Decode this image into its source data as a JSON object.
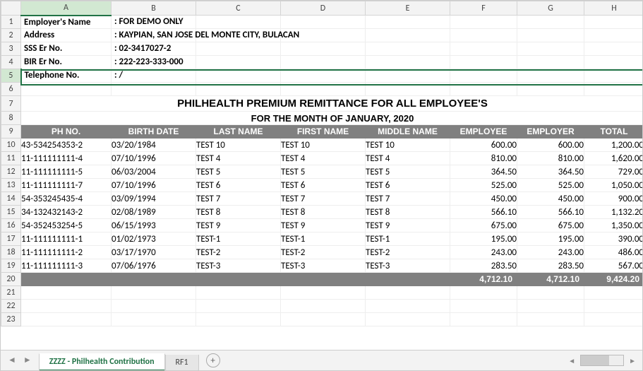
{
  "columns": [
    "A",
    "B",
    "C",
    "D",
    "E",
    "F",
    "G",
    "H"
  ],
  "selected_column": "A",
  "selected_row": 5,
  "info_labels": {
    "employer_name": "Employer's Name",
    "address": "Address",
    "sss": "SSS Er No.",
    "bir": "BIR Er No.",
    "tel": "Telephone No."
  },
  "info_values": {
    "employer_name": ": FOR DEMO ONLY",
    "address": ": KAYPIAN, SAN JOSE DEL MONTE CITY, BULACAN",
    "sss": ": 02-3417027-2",
    "bir": ": 222-223-333-000",
    "tel": ": /"
  },
  "title": "PHILHEALTH PREMIUM REMITTANCE FOR ALL EMPLOYEE'S",
  "subtitle": "FOR THE MONTH OF JANUARY, 2020",
  "headers": [
    "PH NO.",
    "BIRTH DATE",
    "LAST NAME",
    "FIRST NAME",
    "MIDDLE NAME",
    "EMPLOYEE",
    "EMPLOYER",
    "TOTAL"
  ],
  "rows": [
    {
      "ph": "43-534254353-2",
      "bd": "03/20/1984",
      "ln": "TEST 10",
      "fn": "TEST 10",
      "mn": "TEST 10",
      "ee": "600.00",
      "er": "600.00",
      "tot": "1,200.00"
    },
    {
      "ph": "11-111111111-4",
      "bd": "07/10/1996",
      "ln": "TEST 4",
      "fn": "TEST 4",
      "mn": "TEST 4",
      "ee": "810.00",
      "er": "810.00",
      "tot": "1,620.00"
    },
    {
      "ph": "11-111111111-5",
      "bd": "06/03/2004",
      "ln": "TEST 5",
      "fn": "TEST 5",
      "mn": "TEST 5",
      "ee": "364.50",
      "er": "364.50",
      "tot": "729.00"
    },
    {
      "ph": "11-111111111-7",
      "bd": "07/10/1996",
      "ln": "TEST 6",
      "fn": "TEST 6",
      "mn": "TEST 6",
      "ee": "525.00",
      "er": "525.00",
      "tot": "1,050.00"
    },
    {
      "ph": "54-353245435-4",
      "bd": "03/09/1994",
      "ln": "TEST 7",
      "fn": "TEST 7",
      "mn": "TEST 7",
      "ee": "450.00",
      "er": "450.00",
      "tot": "900.00"
    },
    {
      "ph": "34-132432143-2",
      "bd": "02/08/1989",
      "ln": "TEST 8",
      "fn": "TEST 8",
      "mn": "TEST 8",
      "ee": "566.10",
      "er": "566.10",
      "tot": "1,132.20"
    },
    {
      "ph": "54-352453254-5",
      "bd": "06/15/1993",
      "ln": "TEST 9",
      "fn": "TEST 9",
      "mn": "TEST 9",
      "ee": "675.00",
      "er": "675.00",
      "tot": "1,350.00"
    },
    {
      "ph": "11-111111111-1",
      "bd": "01/02/1973",
      "ln": "TEST-1",
      "fn": "TEST-1",
      "mn": "TEST-1",
      "ee": "195.00",
      "er": "195.00",
      "tot": "390.00"
    },
    {
      "ph": "11-111111111-2",
      "bd": "03/17/1970",
      "ln": "TEST-2",
      "fn": "TEST-2",
      "mn": "TEST-2",
      "ee": "243.00",
      "er": "243.00",
      "tot": "486.00"
    },
    {
      "ph": "11-111111111-3",
      "bd": "07/06/1976",
      "ln": "TEST-3",
      "fn": "TEST-3",
      "mn": "TEST-3",
      "ee": "283.50",
      "er": "283.50",
      "tot": "567.00"
    }
  ],
  "totals": {
    "ee": "4,712.10",
    "er": "4,712.10",
    "tot": "9,424.20"
  },
  "tabs": {
    "active": "ZZZZ - Philhealth Contribution",
    "other": "RF1"
  },
  "chart_data": {
    "type": "table",
    "title": "PHILHEALTH PREMIUM REMITTANCE FOR ALL EMPLOYEE'S",
    "subtitle": "FOR THE MONTH OF JANUARY, 2020",
    "columns": [
      "PH NO.",
      "BIRTH DATE",
      "LAST NAME",
      "FIRST NAME",
      "MIDDLE NAME",
      "EMPLOYEE",
      "EMPLOYER",
      "TOTAL"
    ],
    "rows": [
      [
        "43-534254353-2",
        "03/20/1984",
        "TEST 10",
        "TEST 10",
        "TEST 10",
        600.0,
        600.0,
        1200.0
      ],
      [
        "11-111111111-4",
        "07/10/1996",
        "TEST 4",
        "TEST 4",
        "TEST 4",
        810.0,
        810.0,
        1620.0
      ],
      [
        "11-111111111-5",
        "06/03/2004",
        "TEST 5",
        "TEST 5",
        "TEST 5",
        364.5,
        364.5,
        729.0
      ],
      [
        "11-111111111-7",
        "07/10/1996",
        "TEST 6",
        "TEST 6",
        "TEST 6",
        525.0,
        525.0,
        1050.0
      ],
      [
        "54-353245435-4",
        "03/09/1994",
        "TEST 7",
        "TEST 7",
        "TEST 7",
        450.0,
        450.0,
        900.0
      ],
      [
        "34-132432143-2",
        "02/08/1989",
        "TEST 8",
        "TEST 8",
        "TEST 8",
        566.1,
        566.1,
        1132.2
      ],
      [
        "54-352453254-5",
        "06/15/1993",
        "TEST 9",
        "TEST 9",
        "TEST 9",
        675.0,
        675.0,
        1350.0
      ],
      [
        "11-111111111-1",
        "01/02/1973",
        "TEST-1",
        "TEST-1",
        "TEST-1",
        195.0,
        195.0,
        390.0
      ],
      [
        "11-111111111-2",
        "03/17/1970",
        "TEST-2",
        "TEST-2",
        "TEST-2",
        243.0,
        243.0,
        486.0
      ],
      [
        "11-111111111-3",
        "07/06/1976",
        "TEST-3",
        "TEST-3",
        "TEST-3",
        283.5,
        283.5,
        567.0
      ]
    ],
    "totals": {
      "EMPLOYEE": 4712.1,
      "EMPLOYER": 4712.1,
      "TOTAL": 9424.2
    }
  }
}
